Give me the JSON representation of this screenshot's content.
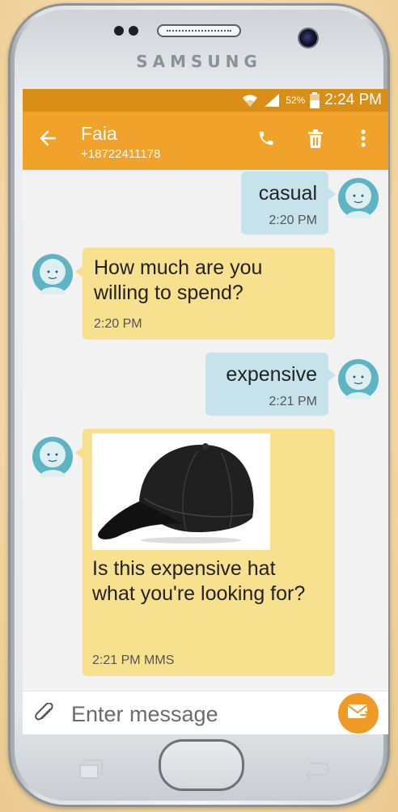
{
  "device": {
    "brand": "SAMSUNG"
  },
  "status_bar": {
    "battery": "52%",
    "time": "2:24 PM"
  },
  "conversation": {
    "contact_name": "Faia",
    "contact_number": "+18722411178"
  },
  "messages": [
    {
      "direction": "outgoing",
      "text": "casual",
      "time": "2:20 PM"
    },
    {
      "direction": "incoming",
      "text": "How much are you willing to spend?",
      "time": "2:20 PM"
    },
    {
      "direction": "outgoing",
      "text": "expensive",
      "time": "2:21 PM"
    },
    {
      "direction": "incoming",
      "image": "black-baseball-cap",
      "text": "Is this expensive hat what you're looking for?",
      "time": "2:21 PM MMS"
    }
  ],
  "composer": {
    "placeholder": "Enter message"
  },
  "icons": {
    "back": "arrow-left-icon",
    "call": "phone-icon",
    "delete": "trash-icon",
    "more": "more-vert-icon",
    "attach": "paperclip-icon",
    "send": "send-mms-icon"
  },
  "colors": {
    "status_bar": "#d98e18",
    "app_bar": "#f0a22a",
    "outgoing_bubble": "#c6e3ec",
    "incoming_bubble": "#f7e08e",
    "send_button": "#f09a26"
  }
}
